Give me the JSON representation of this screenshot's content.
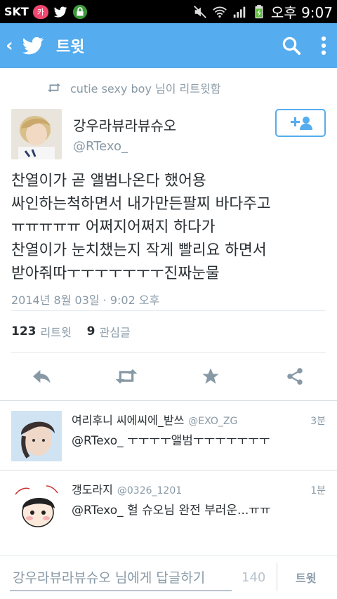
{
  "status_bar": {
    "carrier": "SKT",
    "time": "오후 9:07",
    "notification_badge": "카"
  },
  "header": {
    "title": "트윗"
  },
  "retweet_context": {
    "text": "cutie sexy boy 님이 리트윗함"
  },
  "tweet": {
    "display_name": "강우라뷰라뷰슈오",
    "handle": "@RTexo_",
    "text": "찬열이가 곧 앨범나온다 했어용\n싸인하는척하면서 내가만든팔찌 바다주고\nㅠㅠㅠㅠㅠ 어쩌지어쩌지 하다가\n찬열이가 눈치챘는지 작게 빨리요 하면서\n받아줘따ㅜㅜㅜㅜㅜㅜㅜ진짜눈물",
    "date": "2014년 8월 03일 · 9:02 오후",
    "retweet_count": "123",
    "retweet_label": "리트윗",
    "favorite_count": "9",
    "favorite_label": "관심글"
  },
  "replies": [
    {
      "name": "여리후니 씨에씨에_받쓰",
      "handle": "@EXO_ZG",
      "time": "3분",
      "text": "@RTexo_ ㅜㅜㅜㅜ앨범ㅜㅜㅜㅜㅜㅜㅜ"
    },
    {
      "name": "갱도라지",
      "handle": "@0326_1201",
      "time": "1분",
      "text": "@RTexo_ 헐 슈오님 완전 부러운...ㅠㅠ"
    }
  ],
  "composer": {
    "placeholder": "강우라뷰라뷰슈오 님에게 답글하기",
    "char_count": "140",
    "send_label": "트윗"
  },
  "colors": {
    "brand": "#55acee",
    "muted": "#8899a6",
    "text": "#292f33"
  }
}
